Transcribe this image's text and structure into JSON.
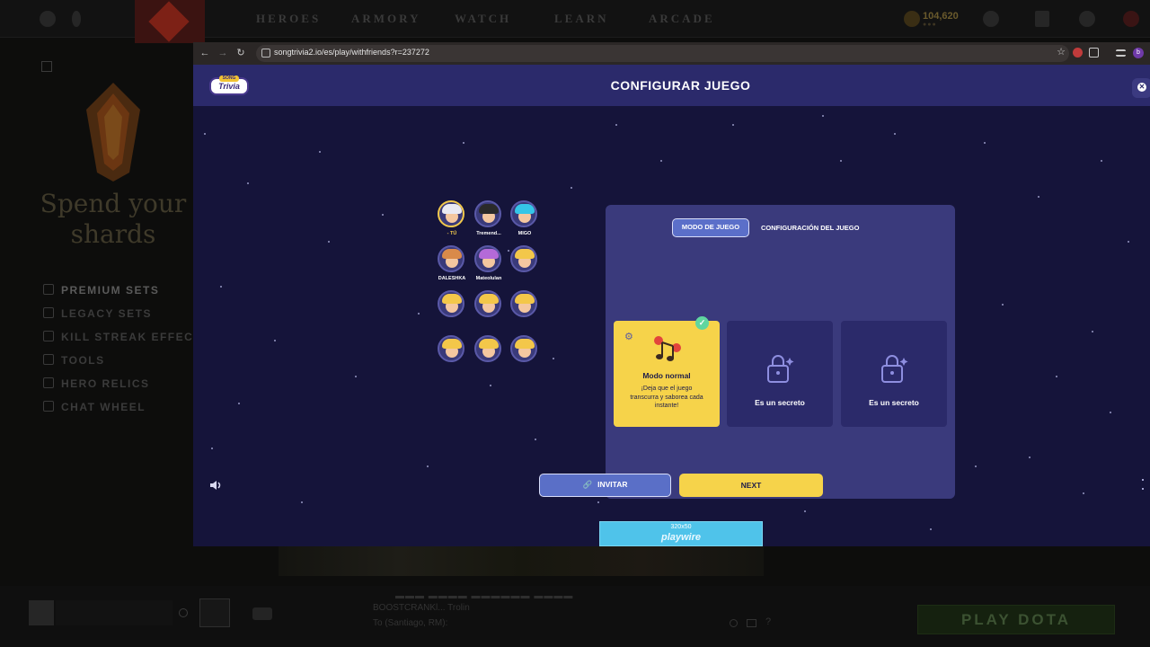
{
  "game_client": {
    "nav": [
      "HEROES",
      "ARMORY",
      "WATCH",
      "LEARN",
      "ARCADE"
    ],
    "gold": "104,620",
    "promo_title": "Spend your shards",
    "menu": [
      "PREMIUM SETS",
      "LEGACY SETS",
      "KILL STREAK EFFECTS",
      "TOOLS",
      "HERO RELICS",
      "CHAT WHEEL"
    ],
    "news_line2": "BOOSTCRANKl... Trolin",
    "news_line3": "To (Santiago, RM):",
    "play_button": "PLAY DOTA"
  },
  "browser": {
    "url": "songtrivia2.io/es/play/withfriends?r=237272",
    "profile_initial": "b"
  },
  "app": {
    "logo_top": "SONG",
    "logo_text": "Trivia",
    "title": "CONFIGURAR JUEGO",
    "players": [
      {
        "name": "- TÚ",
        "hair": "#e9e9f3",
        "self": true
      },
      {
        "name": "Tremend...",
        "hair": "#2a2a2a",
        "self": false
      },
      {
        "name": "MIGO",
        "hair": "#35c6e8",
        "self": false
      },
      {
        "name": "DALESHKA",
        "hair": "#d98a4a",
        "self": false
      },
      {
        "name": "Mateolulan",
        "hair": "#b46ad8",
        "self": false
      }
    ],
    "tabs": {
      "mode": "MODO DE JUEGO",
      "config": "CONFIGURACIÓN DEL JUEGO"
    },
    "modes": {
      "normal_title": "Modo normal",
      "normal_desc": "¡Deja que el juego transcurra y saborea cada instante!",
      "secret_1": "Es un secreto",
      "secret_2": "Es un secreto"
    },
    "buttons": {
      "invite": "INVITAR",
      "next": "NEXT"
    },
    "ad": {
      "size": "320x50",
      "brand": "playwire"
    },
    "colors": {
      "header": "#2b2a6b",
      "stage": "#15143a",
      "panel": "#3a3a7c",
      "accent_yellow": "#f6d34a",
      "accent_blue": "#5b6fc9"
    }
  }
}
